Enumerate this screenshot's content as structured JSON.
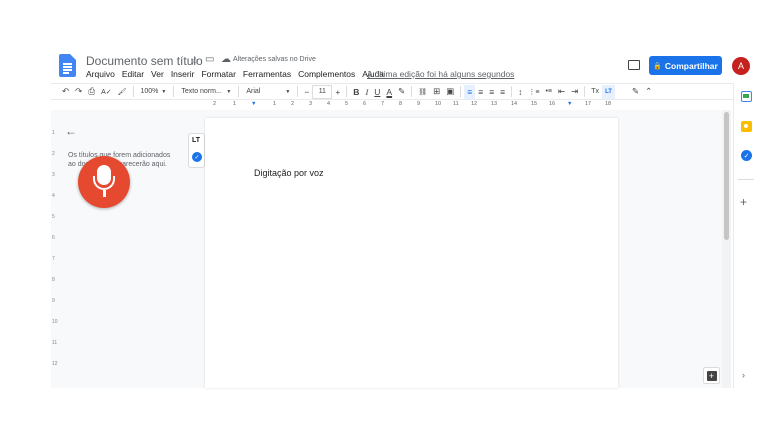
{
  "header": {
    "title": "Documento sem título",
    "star_icon": "☆",
    "folder_icon": "▭",
    "cloud_icon": "☁",
    "saved_status": "Alterações salvas no Drive",
    "last_edit": "A última edição foi há alguns segundos",
    "share_label": "Compartilhar",
    "avatar_initial": "A",
    "accent": "#1a73e8",
    "avatar_color": "#c5221f"
  },
  "menu": [
    "Arquivo",
    "Editar",
    "Ver",
    "Inserir",
    "Formatar",
    "Ferramentas",
    "Complementos",
    "Ajuda"
  ],
  "toolbar": {
    "undo": "↶",
    "redo": "↷",
    "print": "⎙",
    "spell": "A✓",
    "paint": "🖌",
    "zoom": "100%",
    "style": "Texto norm...",
    "font": "Arial",
    "minus": "−",
    "size": "11",
    "plus": "+",
    "bold": "B",
    "italic": "I",
    "underline": "U",
    "text_color": "A",
    "highlight": "✎",
    "link": "⛓",
    "comment": "⊞",
    "image": "▣",
    "align_left": "≡",
    "align_center": "≡",
    "align_right": "≡",
    "justify": "≡",
    "line_spacing": "↕",
    "numbered": "⋮≡",
    "bullets": "•≡",
    "indent_less": "⇤",
    "indent_more": "⇥",
    "clear_format": "Tx",
    "format_option": "LT",
    "edit_mode": "✎",
    "collapse": "⌃"
  },
  "ruler": [
    "2",
    "1",
    "1",
    "2",
    "3",
    "4",
    "5",
    "6",
    "7",
    "8",
    "9",
    "10",
    "11",
    "12",
    "13",
    "14",
    "15",
    "16",
    "17",
    "18"
  ],
  "vertical_ruler": [
    "1",
    "2",
    "3",
    "4",
    "5",
    "6",
    "7",
    "8",
    "9",
    "10",
    "11",
    "12"
  ],
  "outline": {
    "back_icon": "←",
    "text": "Os títulos que forem adicionados ao documento aparecerão aqui."
  },
  "floating": {
    "format_icon": "LT",
    "check_icon": "✓"
  },
  "document": {
    "body_text": "Digitação por voz"
  },
  "side_panel": {
    "tasks_icon": "✓",
    "add_icon": "+",
    "expand_icon": "›"
  },
  "explore_icon": "+"
}
